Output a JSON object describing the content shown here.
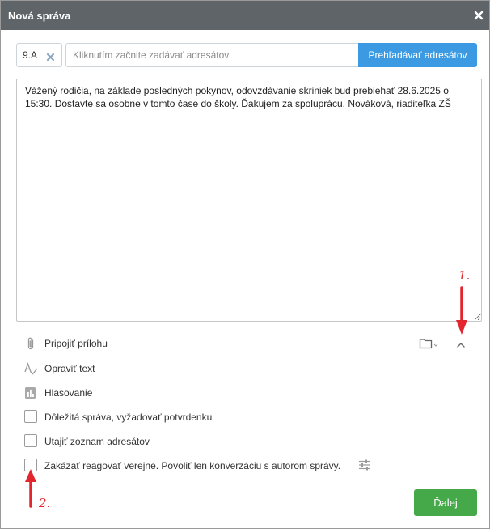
{
  "dialog": {
    "title": "Nová správa"
  },
  "recipients": {
    "tags": [
      {
        "label": "9.A"
      }
    ],
    "input_placeholder": "Kliknutím začnite zadávať adresátov",
    "browse_button": "Prehľadávať adresátov"
  },
  "message": {
    "text": "Vážený rodičia, na základe posledných pokynov, odovzdávanie skriniek bud prebiehať 28.6.2025 o 15:30. Dostavte sa osobne v tomto čase do školy. Ďakujem za spoluprácu. Nováková, riaditeľka ZŠ"
  },
  "options": {
    "attach_label": "Pripojiť prílohu",
    "spellcheck_label": "Opraviť text",
    "poll_label": "Hlasovanie",
    "checkboxes": [
      {
        "label": "Dôležitá správa, vyžadovať potvrdenku",
        "checked": false
      },
      {
        "label": "Utajiť zoznam adresátov",
        "checked": false
      },
      {
        "label": "Zakázať reagovať verejne. Povoliť len konverzáciu s autorom správy.",
        "checked": false
      }
    ]
  },
  "annotations": {
    "marker1": "1.",
    "marker2": "2."
  },
  "footer": {
    "next_button": "Ďalej"
  },
  "colors": {
    "titlebar": "#5f6468",
    "primary_button": "#3b9ae1",
    "next_button": "#45a849",
    "annotation_red": "#e3262e"
  },
  "icons": {
    "close": "close-icon",
    "tag_remove": "tag-remove-icon",
    "paperclip": "paperclip-icon",
    "spellcheck": "spellcheck-icon",
    "poll": "poll-icon",
    "folder": "folder-icon",
    "collapse": "chevron-up-icon",
    "settings": "sliders-icon"
  }
}
